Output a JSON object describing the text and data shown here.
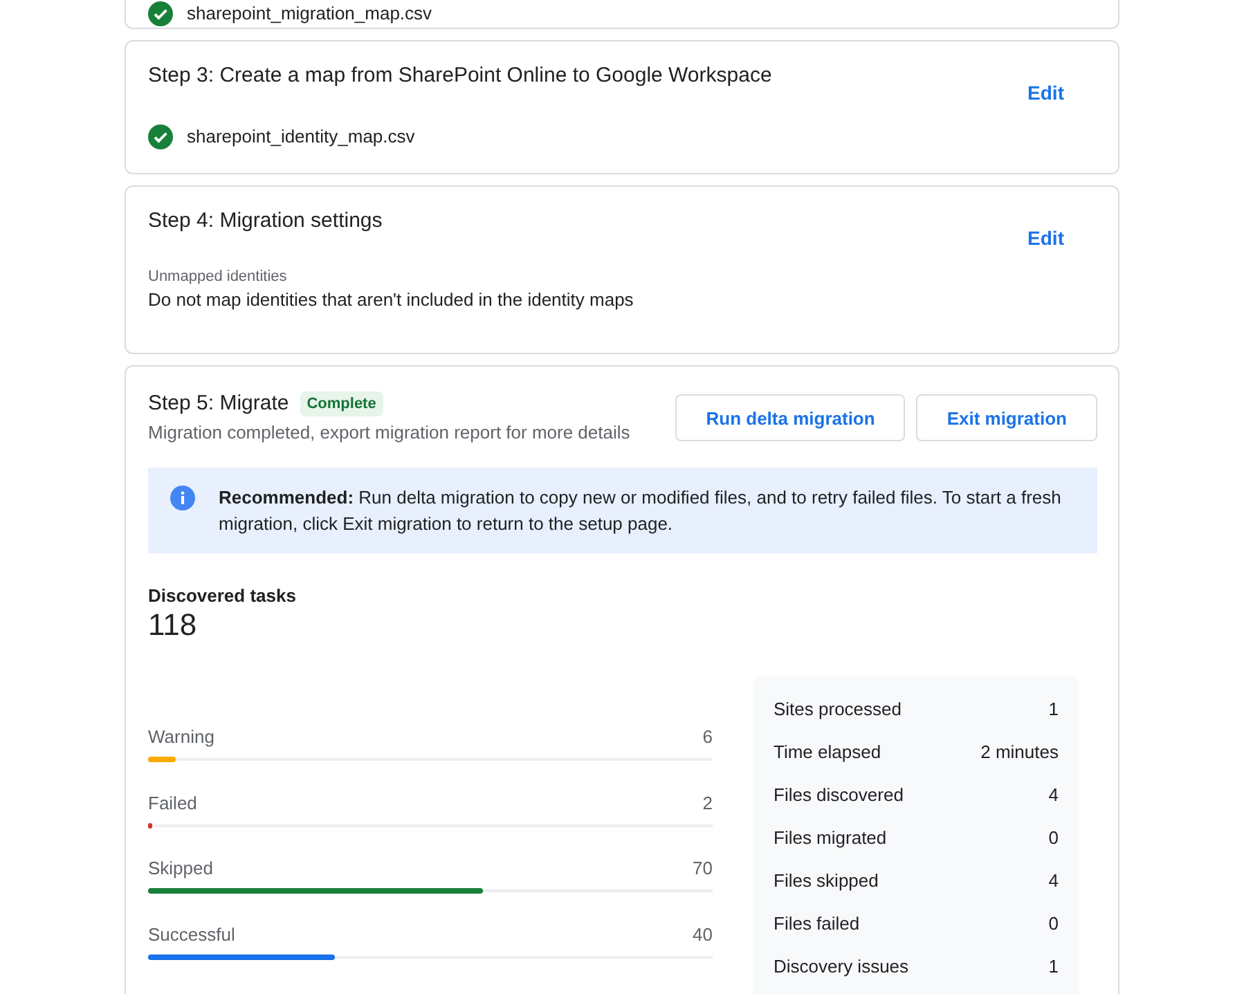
{
  "steps": [
    {
      "kind": "file",
      "file": "sharepoint_migration_map.csv"
    },
    {
      "kind": "file",
      "title": "Step 3: Create a map from SharePoint Online to Google Workspace",
      "action": "Edit",
      "file": "sharepoint_identity_map.csv"
    },
    {
      "kind": "setting",
      "title": "Step 4: Migration settings",
      "action": "Edit",
      "setting_label": "Unmapped identities",
      "setting_value": "Do not map identities that aren't included in the identity maps"
    }
  ],
  "migrate": {
    "title": "Step 5: Migrate",
    "badge": "Complete",
    "subtitle": "Migration completed, export migration report for more details",
    "buttons": [
      "Run delta migration",
      "Exit migration"
    ],
    "banner": "**Recommended:** Run delta migration to copy new or modified files, and to retry failed files. To start a fresh migration, click Exit migration to return to the setup page.",
    "discovered": {
      "label": "Discovered tasks",
      "value": "118"
    },
    "bars": [
      {
        "label": "Warning",
        "value": "6",
        "level": 0.05,
        "color": "#f9ab00"
      },
      {
        "label": "Failed",
        "value": "2",
        "level": 0.008,
        "color": "#d93025"
      },
      {
        "label": "Skipped",
        "value": "70",
        "level": 0.593,
        "color": "#188038"
      },
      {
        "label": "Successful",
        "value": "40",
        "level": 0.33,
        "color": "#1a73e8"
      }
    ],
    "stats": [
      {
        "label": "Sites processed",
        "value": "1"
      },
      {
        "label": "Time elapsed",
        "value": "2 minutes"
      },
      {
        "label": "Files discovered",
        "value": "4"
      },
      {
        "label": "Files migrated",
        "value": "0"
      },
      {
        "label": "Files skipped",
        "value": "4"
      },
      {
        "label": "Files failed",
        "value": "0"
      },
      {
        "label": "Discovery issues",
        "value": "1"
      }
    ]
  }
}
